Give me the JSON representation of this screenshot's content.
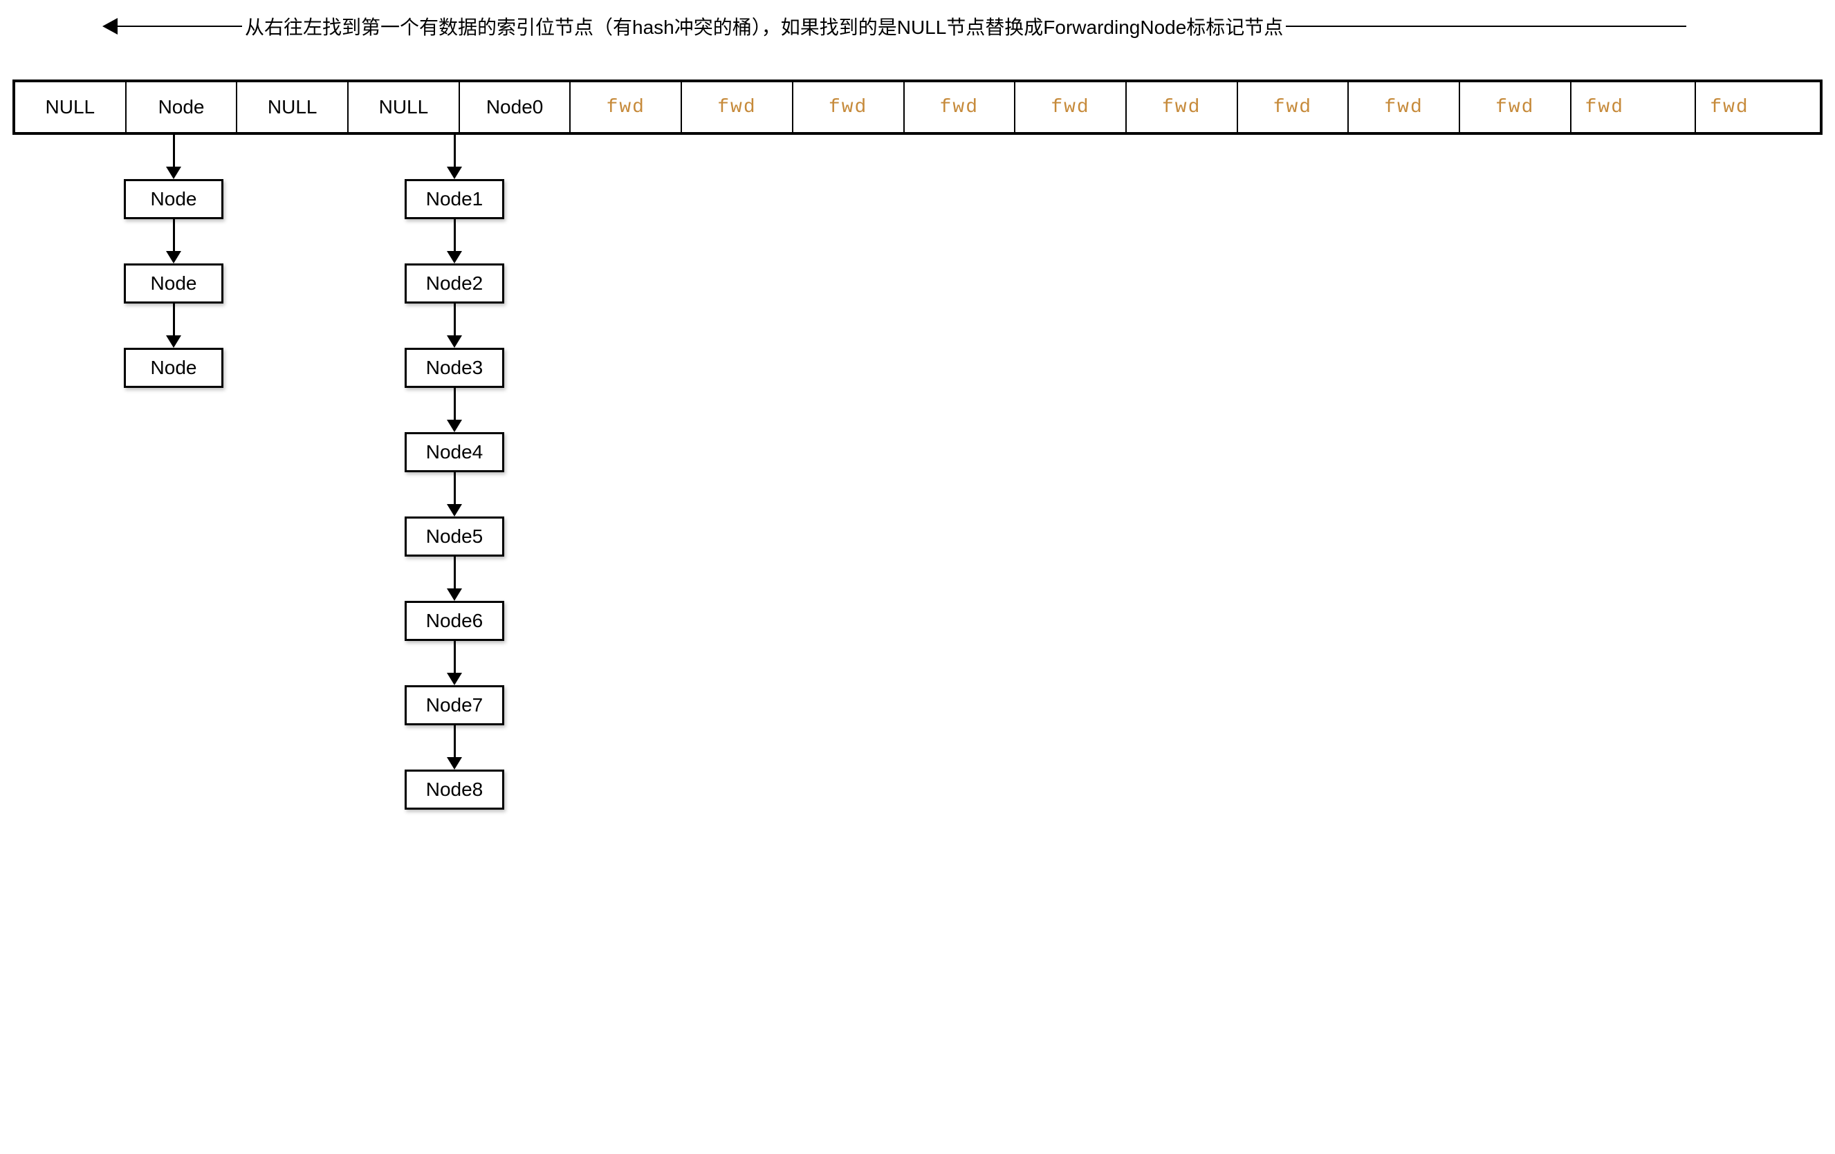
{
  "header": {
    "text": "从右往左找到第一个有数据的索引位节点（有hash冲突的桶），如果找到的是NULL节点替换成ForwardingNode标标记节点"
  },
  "table": {
    "cells": [
      {
        "label": "NULL",
        "kind": "null"
      },
      {
        "label": "Node",
        "kind": "node"
      },
      {
        "label": "NULL",
        "kind": "null"
      },
      {
        "label": "NULL",
        "kind": "null"
      },
      {
        "label": "Node0",
        "kind": "node"
      },
      {
        "label": "fwd",
        "kind": "fwd-center"
      },
      {
        "label": "fwd",
        "kind": "fwd-center"
      },
      {
        "label": "fwd",
        "kind": "fwd-center"
      },
      {
        "label": "fwd",
        "kind": "fwd-center"
      },
      {
        "label": "fwd",
        "kind": "fwd-center"
      },
      {
        "label": "fwd",
        "kind": "fwd-center"
      },
      {
        "label": "fwd",
        "kind": "fwd-center"
      },
      {
        "label": "fwd",
        "kind": "fwd-center"
      },
      {
        "label": "fwd",
        "kind": "fwd-center"
      },
      {
        "label": "fwd",
        "kind": "fwd"
      },
      {
        "label": "fwd",
        "kind": "fwd"
      }
    ]
  },
  "chains": {
    "chain1": [
      {
        "label": "Node"
      },
      {
        "label": "Node"
      },
      {
        "label": "Node"
      }
    ],
    "chain2": [
      {
        "label": "Node1"
      },
      {
        "label": "Node2"
      },
      {
        "label": "Node3"
      },
      {
        "label": "Node4"
      },
      {
        "label": "Node5"
      },
      {
        "label": "Node6"
      },
      {
        "label": "Node7"
      },
      {
        "label": "Node8"
      }
    ]
  }
}
